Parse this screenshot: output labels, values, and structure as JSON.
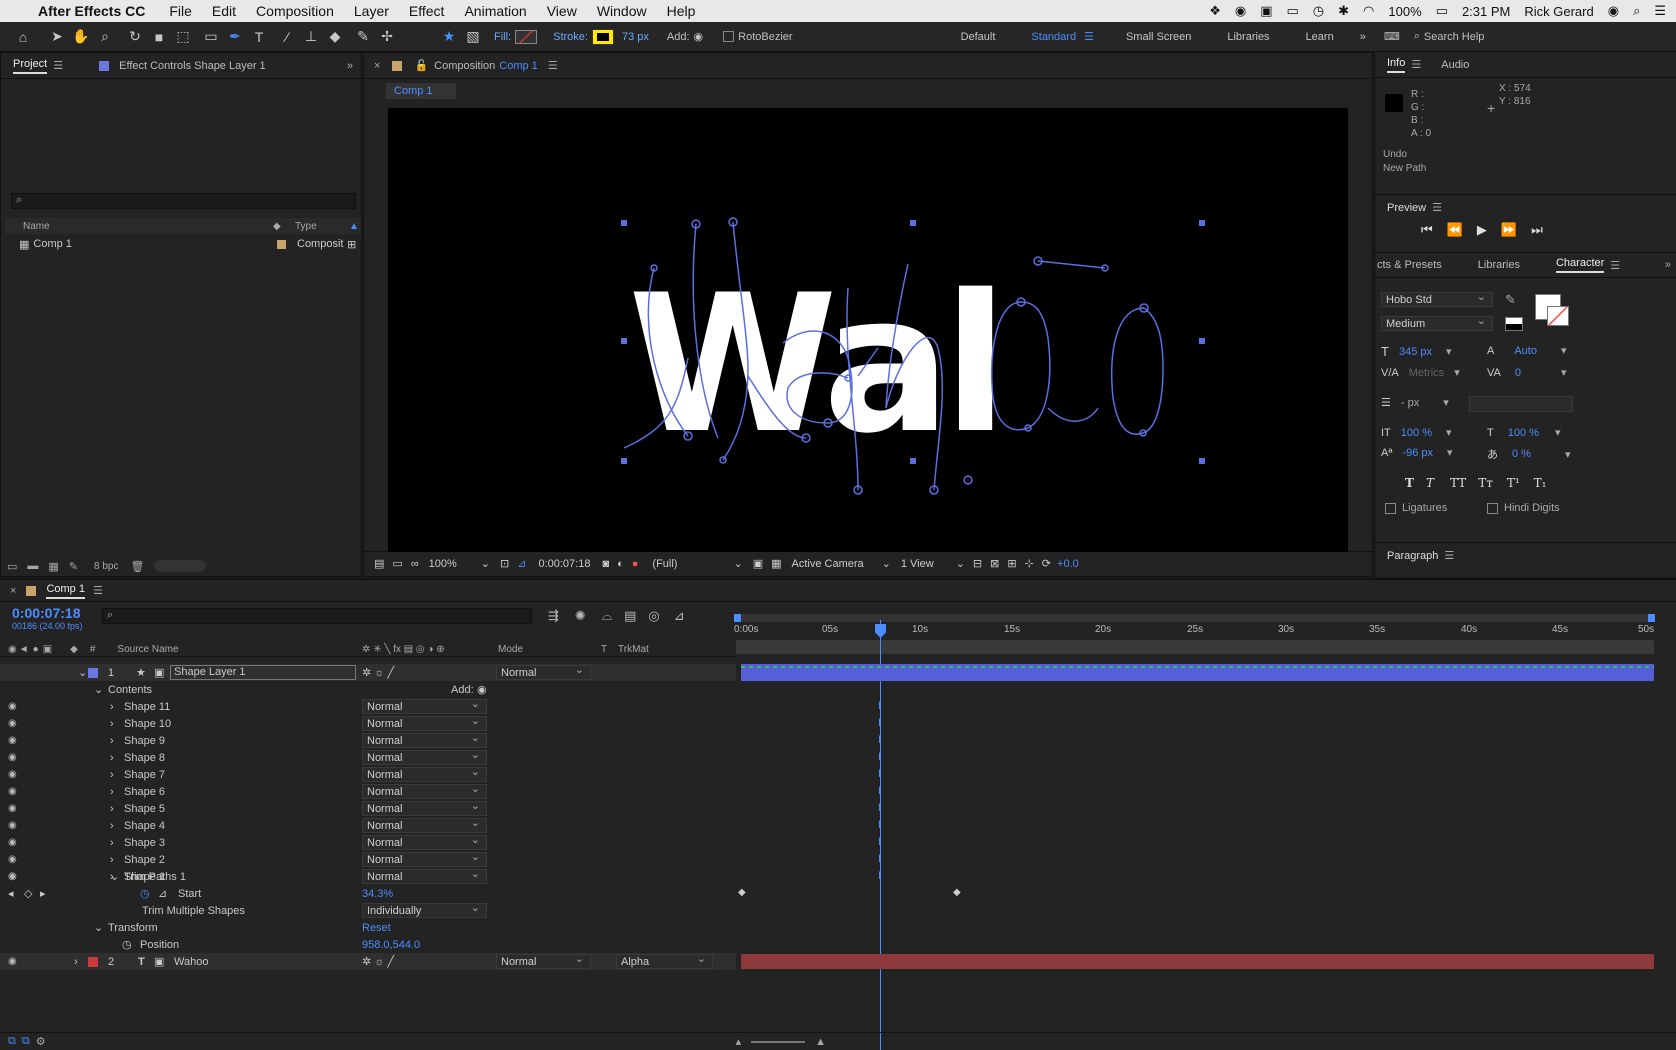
{
  "menubar": {
    "app": "After Effects CC",
    "items": [
      "File",
      "Edit",
      "Composition",
      "Layer",
      "Effect",
      "Animation",
      "View",
      "Window",
      "Help"
    ],
    "battery": "100%",
    "time": "2:31 PM",
    "user": "Rick Gerard"
  },
  "toolbar": {
    "fill_label": "Fill:",
    "stroke_label": "Stroke:",
    "stroke_width": "73 px",
    "add_label": "Add:",
    "rotobezier_label": "RotoBezier",
    "workspaces": [
      "Default",
      "Standard",
      "Small Screen",
      "Libraries",
      "Learn"
    ],
    "active_workspace": "Standard",
    "search_help": "Search Help"
  },
  "project": {
    "tab_project": "Project",
    "tab_effect_controls": "Effect Controls Shape Layer 1",
    "col_name": "Name",
    "col_type": "Type",
    "item_name": "Comp 1",
    "item_type": "Composit",
    "bpc": "8 bpc"
  },
  "comp_viewer": {
    "tab_label": "Composition",
    "tab_comp_name": "Comp 1",
    "sub_tab": "Comp 1",
    "zoom": "100%",
    "timecode": "0:00:07:18",
    "resolution": "(Full)",
    "camera": "Active Camera",
    "views": "1 View",
    "exposure": "+0.0",
    "canvas_text": "Wal"
  },
  "info": {
    "tab_info": "Info",
    "tab_audio": "Audio",
    "r": "R :",
    "g": "G :",
    "b": "B :",
    "a": "A :  0",
    "x": "X : 574",
    "y": "Y : 816",
    "undo": "Undo",
    "action": "New Path"
  },
  "preview": {
    "title": "Preview"
  },
  "character": {
    "tab_effects": "cts & Presets",
    "tab_libraries": "Libraries",
    "tab_character": "Character",
    "font": "Hobo Std",
    "style": "Medium",
    "size": "345 px",
    "leading": "Auto",
    "kerning": "Metrics",
    "tracking": "0",
    "stroke_width": "- px",
    "vscale": "100 %",
    "hscale": "100 %",
    "baseline": "-96 px",
    "tsume": "0 %",
    "ligatures": "Ligatures",
    "hindi_digits": "Hindi Digits",
    "paragraph": "Paragraph"
  },
  "timeline": {
    "tab": "Comp 1",
    "timecode": "0:00:07:18",
    "frames": "00186 (24.00 fps)",
    "col_source": "Source Name",
    "col_mode": "Mode",
    "col_t": "T",
    "col_trkmat": "TrkMat",
    "ruler": [
      "0:00s",
      "05s",
      "10s",
      "15s",
      "20s",
      "25s",
      "30s",
      "35s",
      "40s",
      "45s",
      "50s"
    ],
    "layer1": {
      "num": "1",
      "name": "Shape Layer 1",
      "mode": "Normal"
    },
    "contents": "Contents",
    "add": "Add:",
    "shapes": [
      {
        "name": "Shape 11",
        "mode": "Normal"
      },
      {
        "name": "Shape 10",
        "mode": "Normal"
      },
      {
        "name": "Shape 9",
        "mode": "Normal"
      },
      {
        "name": "Shape 8",
        "mode": "Normal"
      },
      {
        "name": "Shape 7",
        "mode": "Normal"
      },
      {
        "name": "Shape 6",
        "mode": "Normal"
      },
      {
        "name": "Shape 5",
        "mode": "Normal"
      },
      {
        "name": "Shape 4",
        "mode": "Normal"
      },
      {
        "name": "Shape 3",
        "mode": "Normal"
      },
      {
        "name": "Shape 2",
        "mode": "Normal"
      },
      {
        "name": "Shape 1",
        "mode": "Normal"
      }
    ],
    "trim_paths": "Trim Paths 1",
    "start_label": "Start",
    "start_value": "34.3%",
    "trim_multiple": "Trim Multiple Shapes",
    "trim_multiple_value": "Individually",
    "transform": "Transform",
    "reset": "Reset",
    "position_label": "Position",
    "position_value": "958.0,544.0",
    "layer2": {
      "num": "2",
      "name": "Wahoo",
      "mode": "Normal",
      "trkmat": "Alpha"
    }
  },
  "colors": {
    "accent": "#4c8dff",
    "layer1_bar": "#5560d8",
    "layer2_bar": "#8f3a3a",
    "stroke_swatch": "#ffea00"
  }
}
